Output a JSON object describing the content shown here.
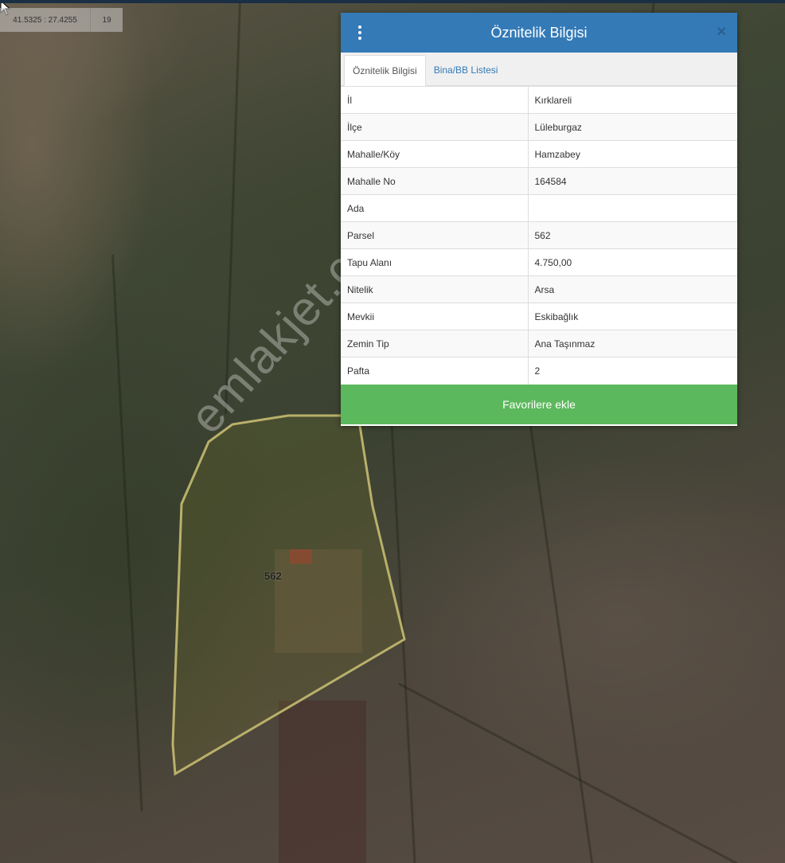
{
  "map": {
    "coordinates": "41.5325 : 27.4255",
    "zoom": "19",
    "parcel_label": "562",
    "watermark": "emlakjet.com",
    "parcel_outline_color": "#b9b06a"
  },
  "panel": {
    "title": "Öznitelik Bilgisi",
    "close_glyph": "×",
    "tabs": [
      {
        "label": "Öznitelik Bilgisi"
      },
      {
        "label": "Bina/BB Listesi"
      }
    ],
    "rows": [
      {
        "key": "İl",
        "value": "Kırklareli"
      },
      {
        "key": "İlçe",
        "value": "Lüleburgaz"
      },
      {
        "key": "Mahalle/Köy",
        "value": "Hamzabey"
      },
      {
        "key": "Mahalle No",
        "value": "164584"
      },
      {
        "key": "Ada",
        "value": ""
      },
      {
        "key": "Parsel",
        "value": "562"
      },
      {
        "key": "Tapu Alanı",
        "value": "4.750,00"
      },
      {
        "key": "Nitelik",
        "value": "Arsa"
      },
      {
        "key": "Mevkii",
        "value": "Eskibağlık"
      },
      {
        "key": "Zemin Tip",
        "value": "Ana Taşınmaz"
      },
      {
        "key": "Pafta",
        "value": "2"
      }
    ],
    "favorite_button": "Favorilere ekle",
    "header_color": "#337ab7",
    "button_color": "#5cb85c"
  }
}
